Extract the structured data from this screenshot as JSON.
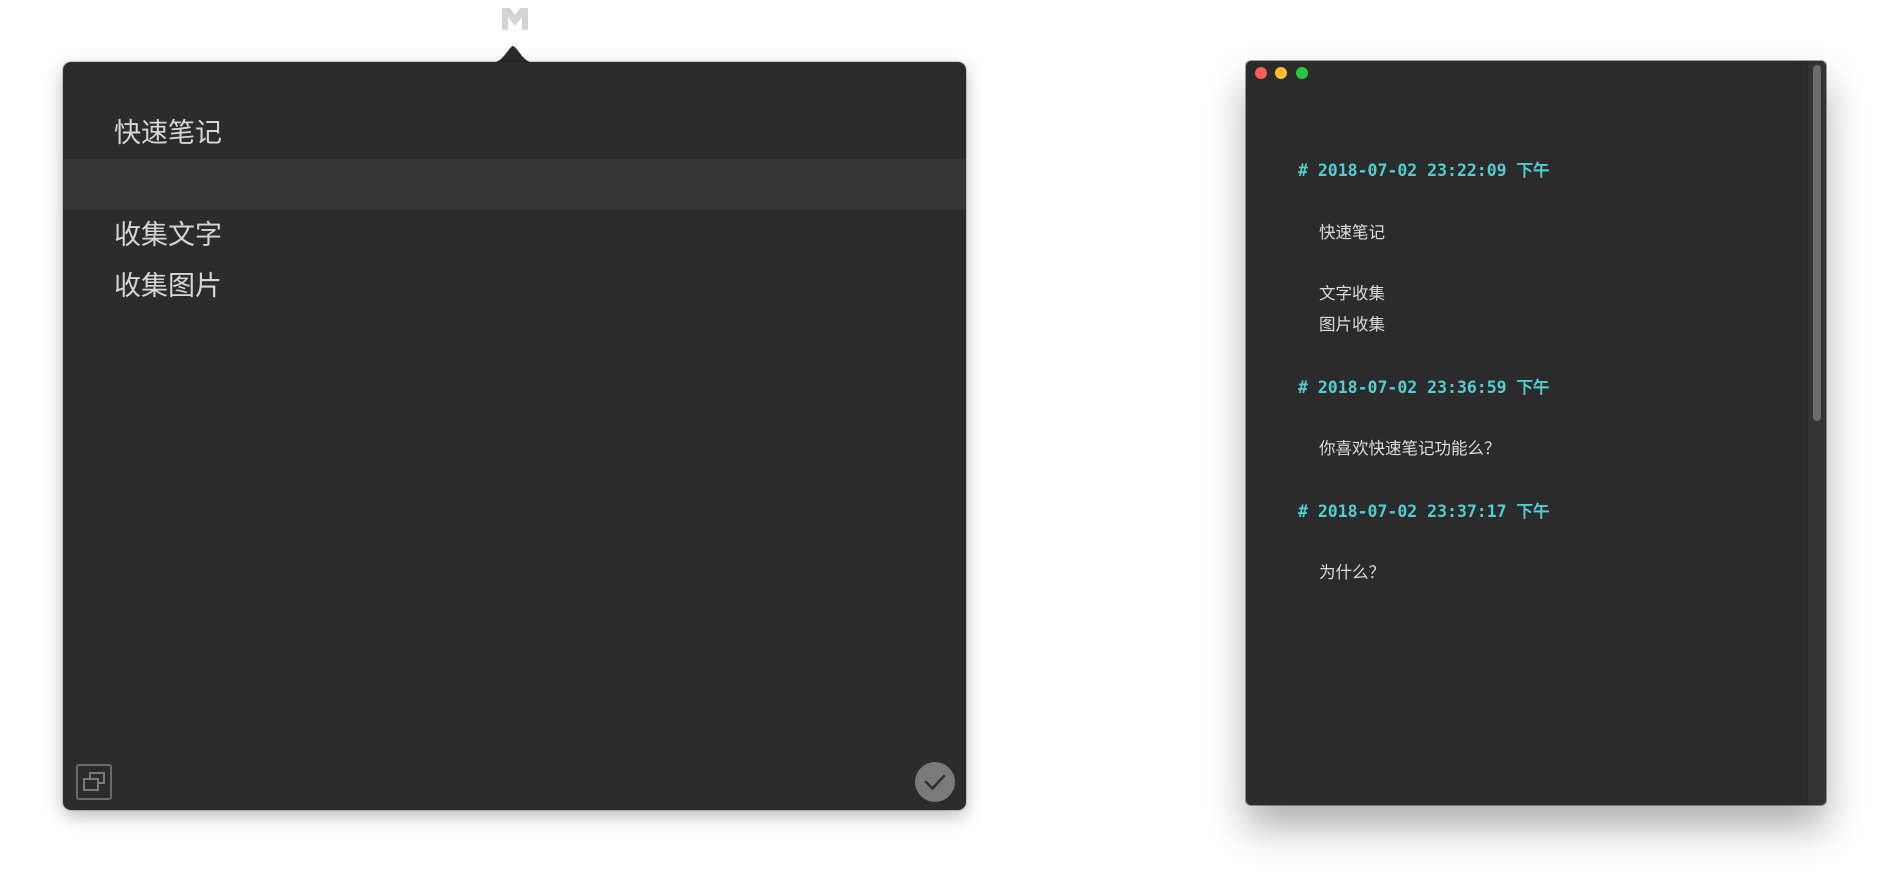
{
  "popover": {
    "lines": [
      {
        "text": "快速笔记"
      },
      {
        "text": ""
      },
      {
        "text": "收集文字"
      },
      {
        "text": "收集图片"
      }
    ],
    "footer_left_icon": "windows-icon",
    "footer_right_icon": "checkmark-icon"
  },
  "menubar": {
    "icon": "m-icon"
  },
  "editor": {
    "entries": [
      {
        "heading": "# 2018-07-02 23:22:09 下午",
        "lines": [
          "快速笔记",
          "文字收集",
          "图片收集"
        ]
      },
      {
        "heading": "# 2018-07-02 23:36:59 下午",
        "lines": [
          "你喜欢快速笔记功能么？"
        ]
      },
      {
        "heading": "# 2018-07-02 23:37:17 下午",
        "lines": [
          "为什么？"
        ]
      }
    ]
  },
  "colors": {
    "panel_bg": "#2c2c2c",
    "heading": "#52cdd2",
    "body_text": "#dcdcdc",
    "close": "#fc5f57",
    "minimize": "#fdbd2e",
    "zoom": "#28c840"
  }
}
